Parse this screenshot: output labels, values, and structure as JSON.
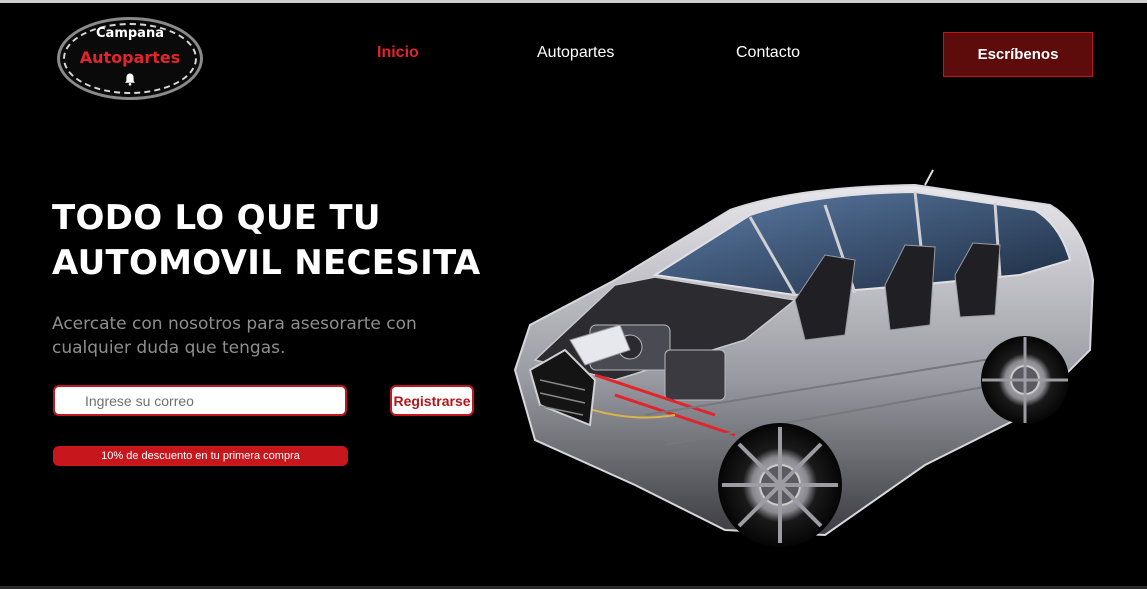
{
  "logo": {
    "line1": "Campana",
    "line2": "Autopartes",
    "icon": "bell-icon"
  },
  "nav": {
    "items": [
      {
        "label": "Inicio",
        "active": true
      },
      {
        "label": "Autopartes",
        "active": false
      },
      {
        "label": "Contacto",
        "active": false
      }
    ],
    "cta_label": "Escríbenos"
  },
  "hero": {
    "title_line1": "TODO LO QUE TU",
    "title_line2": "AUTOMOVIL NECESITA",
    "subtitle": "Acercate con nosotros para asesorarte con cualquier duda que tengas.",
    "email_placeholder": "Ingrese su correo",
    "email_value": "",
    "register_label": "Registrarse",
    "discount_text": "10% de descuento en tu primera compra"
  },
  "colors": {
    "background": "#000000",
    "accent": "#e3242b",
    "cta_bg": "#5d0b0b",
    "text": "#ffffff",
    "muted": "#8e8e8e"
  },
  "illustration": {
    "subject": "cutaway-suv-image"
  }
}
